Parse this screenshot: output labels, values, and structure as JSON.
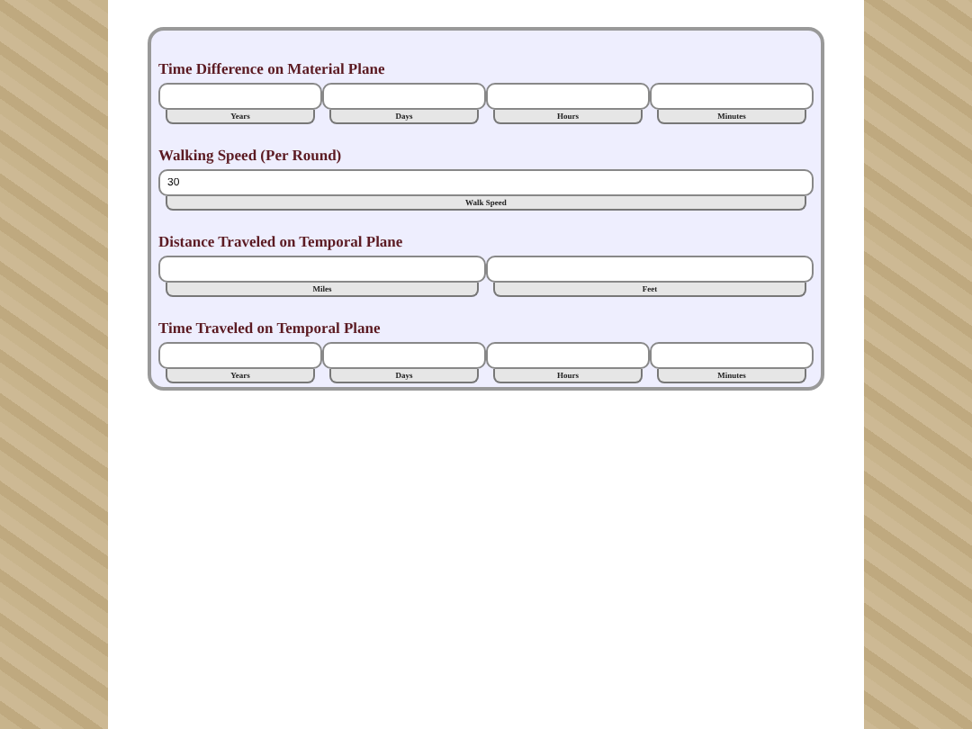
{
  "sections": [
    {
      "title": "Time Difference on Material Plane",
      "fields": [
        {
          "label": "Years"
        },
        {
          "label": "Days"
        },
        {
          "label": "Hours"
        },
        {
          "label": "Minutes"
        }
      ]
    },
    {
      "title": "Walking Speed (Per Round)",
      "fields": [
        {
          "label": "Walk Speed",
          "value": "30"
        }
      ]
    },
    {
      "title": "Distance Traveled on Temporal Plane",
      "fields": [
        {
          "label": "Miles"
        },
        {
          "label": "Feet"
        }
      ]
    },
    {
      "title": "Time Traveled on Temporal Plane",
      "fields": [
        {
          "label": "Years"
        },
        {
          "label": "Days"
        },
        {
          "label": "Hours"
        },
        {
          "label": "Minutes"
        }
      ]
    }
  ]
}
